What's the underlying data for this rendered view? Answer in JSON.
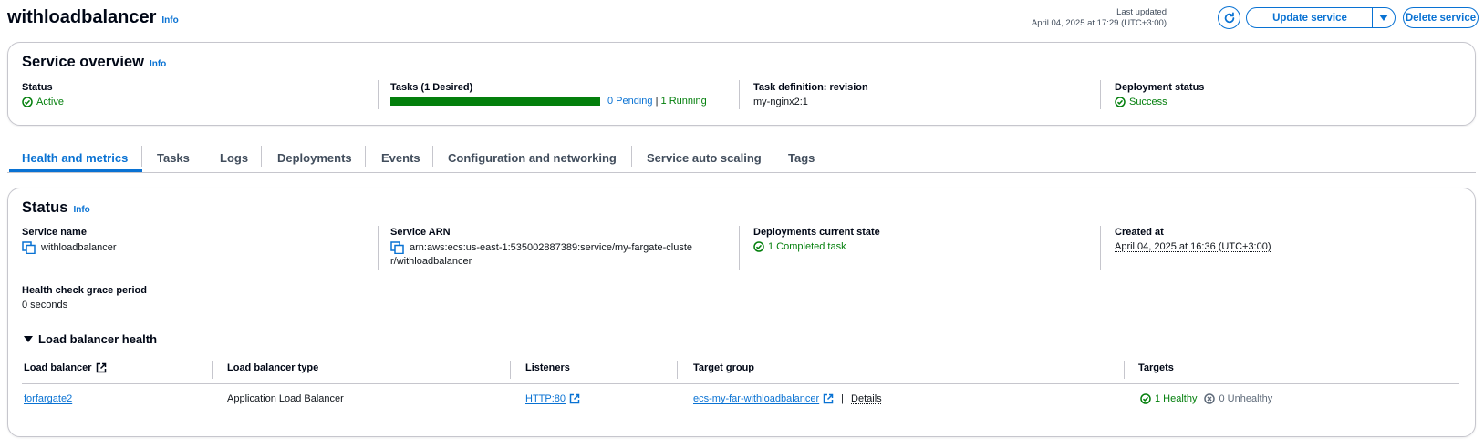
{
  "header": {
    "title": "withloadbalancer",
    "info_label": "Info",
    "last_updated_label": "Last updated",
    "last_updated_value": "April 04, 2025 at 17:29 (UTC+3:00)",
    "update_button": "Update service",
    "delete_button": "Delete service"
  },
  "overview": {
    "title": "Service overview",
    "info_label": "Info",
    "status_label": "Status",
    "status_value": "Active",
    "tasks_label": "Tasks (1 Desired)",
    "tasks_running_fraction": 1.0,
    "tasks_pending": "0 Pending",
    "tasks_separator": "|",
    "tasks_running": "1 Running",
    "task_def_label": "Task definition: revision",
    "task_def_value": "my-nginx2:1",
    "deploy_status_label": "Deployment status",
    "deploy_status_value": "Success"
  },
  "tabs": [
    {
      "label": "Health and metrics",
      "active": true
    },
    {
      "label": "Tasks"
    },
    {
      "label": "Logs"
    },
    {
      "label": "Deployments"
    },
    {
      "label": "Events"
    },
    {
      "label": "Configuration and networking"
    },
    {
      "label": "Service auto scaling"
    },
    {
      "label": "Tags"
    }
  ],
  "status": {
    "title": "Status",
    "info_label": "Info",
    "service_name_label": "Service name",
    "service_name_value": "withloadbalancer",
    "service_arn_label": "Service ARN",
    "service_arn_line1": "arn:aws:ecs:us-east-1:535002887389:service/my-fargate-cluste",
    "service_arn_line2": "r/withloadbalancer",
    "deployments_state_label": "Deployments current state",
    "deployments_state_value": "1 Completed task",
    "created_at_label": "Created at",
    "created_at_value": "April 04, 2025 at 16:36 (UTC+3:00)",
    "grace_label": "Health check grace period",
    "grace_value": "0 seconds",
    "lb_health_label": "Load balancer health"
  },
  "lb_table": {
    "headers": [
      "Load balancer",
      "Load balancer type",
      "Listeners",
      "Target group",
      "Targets"
    ],
    "row": {
      "load_balancer": "forfargate2",
      "type": "Application Load Balancer",
      "listener": "HTTP:80",
      "target_group": "ecs-my-far-withloadbalancer",
      "separator": "|",
      "details": "Details",
      "healthy": "1 Healthy",
      "unhealthy": "0 Unhealthy"
    }
  },
  "colors": {
    "accent": "#0972d3",
    "success": "#037f0c",
    "border": "#c6c6cd"
  }
}
